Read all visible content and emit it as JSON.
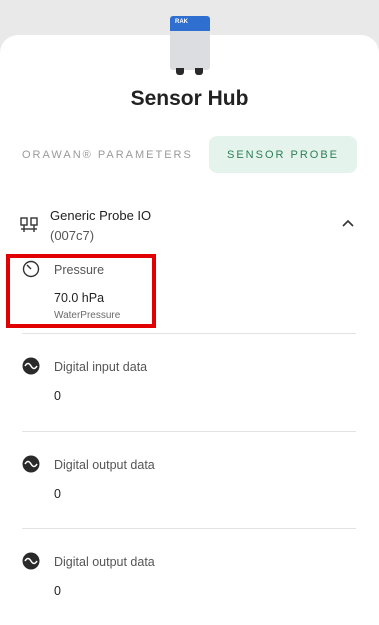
{
  "device": {
    "brand": "RAK"
  },
  "title": "Sensor Hub",
  "tabs": {
    "parameters": "ORAWAN® PARAMETERS",
    "probe": "SENSOR PROBE"
  },
  "probe": {
    "name": "Generic Probe IO",
    "id": "(007c7)"
  },
  "rows": [
    {
      "label": "Pressure",
      "value": "70.0 hPa",
      "sub": "WaterPressure",
      "icon": "gauge-icon"
    },
    {
      "label": "Digital input data",
      "value": "0",
      "icon": "wave-icon"
    },
    {
      "label": "Digital output data",
      "value": "0",
      "icon": "wave-icon"
    },
    {
      "label": "Digital output data",
      "value": "0",
      "icon": "wave-icon"
    }
  ],
  "colors": {
    "accent": "#2f7d58",
    "accent_bg": "#e4f4ec",
    "highlight": "#e00000"
  }
}
